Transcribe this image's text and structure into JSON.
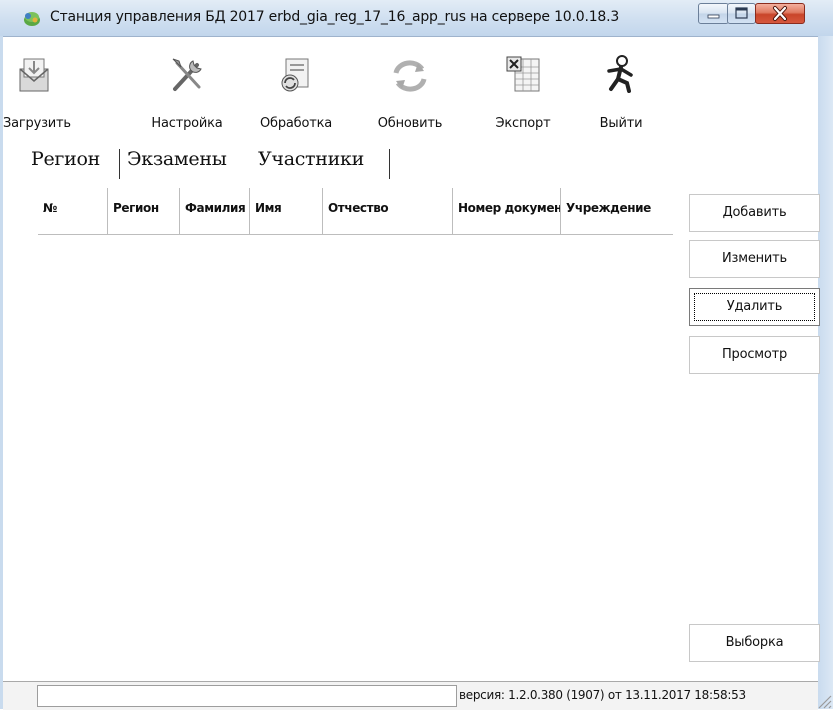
{
  "window": {
    "title": "Станция управления БД 2017 erbd_gia_reg_17_16_app_rus на сервере 10.0.18.3"
  },
  "toolbar": {
    "items": [
      {
        "label": "Загрузить",
        "icon": "load-icon"
      },
      {
        "label": "Настройка",
        "icon": "settings-tools-icon"
      },
      {
        "label": "Обработка",
        "icon": "processing-icon"
      },
      {
        "label": "Обновить",
        "icon": "refresh-icon"
      },
      {
        "label": "Экспорт",
        "icon": "excel-export-icon"
      },
      {
        "label": "Выйти",
        "icon": "exit-runner-icon"
      }
    ]
  },
  "tabs": [
    {
      "label": "Регион"
    },
    {
      "label": "Экзамены"
    },
    {
      "label": "Участники",
      "selected": true
    }
  ],
  "grid": {
    "columns": [
      "№",
      "Регион",
      "Фамилия",
      "Имя",
      "Отчество",
      "Номер документа",
      "Учреждение"
    ],
    "rows": []
  },
  "buttons": {
    "add": "Добавить",
    "edit": "Изменить",
    "delete": "Удалить",
    "view": "Просмотр",
    "selection": "Выборка"
  },
  "status": {
    "version": "версия: 1.2.0.380 (1907) от 13.11.2017 18:58:53"
  },
  "colors": {
    "titlebar": "#cfdff0",
    "close_button": "#c9452a",
    "window_bg": "#ffffff"
  }
}
